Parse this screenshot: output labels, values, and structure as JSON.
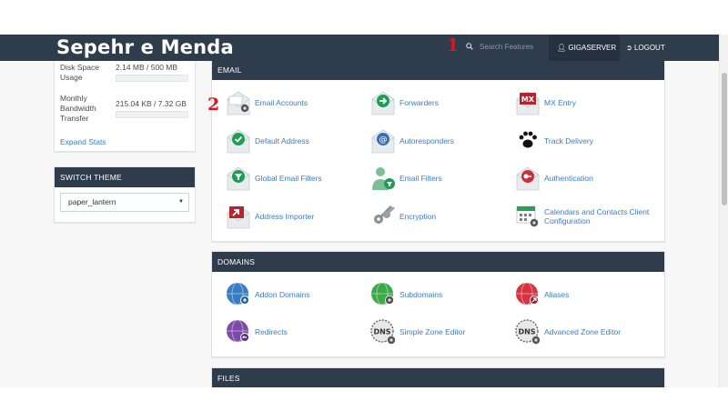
{
  "header": {
    "brand": "Sepehr e Menda",
    "search_placeholder": "Search Features",
    "user_label": "GIGASERVER",
    "logout_label": "LOGOUT",
    "annotation_1": "1",
    "annotation_2": "2"
  },
  "stats": {
    "disk_label": "Disk Space Usage",
    "disk_value": "2.14 MB / 500 MB",
    "bandwidth_label": "Monthly Bandwidth Transfer",
    "bandwidth_value": "215.04 KB / 7.32 GB",
    "expand_label": "Expand Stats"
  },
  "theme": {
    "title": "SWITCH THEME",
    "selected": "paper_lantern"
  },
  "email": {
    "title": "EMAIL",
    "items": [
      {
        "label": "Email Accounts",
        "icon": "email-accounts-icon"
      },
      {
        "label": "Forwarders",
        "icon": "forwarders-icon"
      },
      {
        "label": "MX Entry",
        "icon": "mx-entry-icon"
      },
      {
        "label": "Default Address",
        "icon": "default-address-icon"
      },
      {
        "label": "Autoresponders",
        "icon": "autoresponders-icon"
      },
      {
        "label": "Track Delivery",
        "icon": "track-delivery-icon"
      },
      {
        "label": "Global Email Filters",
        "icon": "global-filters-icon"
      },
      {
        "label": "Email Filters",
        "icon": "email-filters-icon"
      },
      {
        "label": "Authentication",
        "icon": "authentication-icon"
      },
      {
        "label": "Address Importer",
        "icon": "address-importer-icon"
      },
      {
        "label": "Encryption",
        "icon": "encryption-icon"
      },
      {
        "label": "Calendars and Contacts Client Configuration",
        "icon": "calendars-icon"
      }
    ]
  },
  "domains": {
    "title": "DOMAINS",
    "items": [
      {
        "label": "Addon Domains",
        "icon": "addon-domains-icon"
      },
      {
        "label": "Subdomains",
        "icon": "subdomains-icon"
      },
      {
        "label": "Aliases",
        "icon": "aliases-icon"
      },
      {
        "label": "Redirects",
        "icon": "redirects-icon"
      },
      {
        "label": "Simple Zone Editor",
        "icon": "simple-zone-editor-icon"
      },
      {
        "label": "Advanced Zone Editor",
        "icon": "advanced-zone-editor-icon"
      }
    ]
  },
  "files": {
    "title": "FILES"
  },
  "colors": {
    "header_bg": "#2f3c4c",
    "link": "#3a7cc4",
    "annotation": "#e0141c"
  }
}
